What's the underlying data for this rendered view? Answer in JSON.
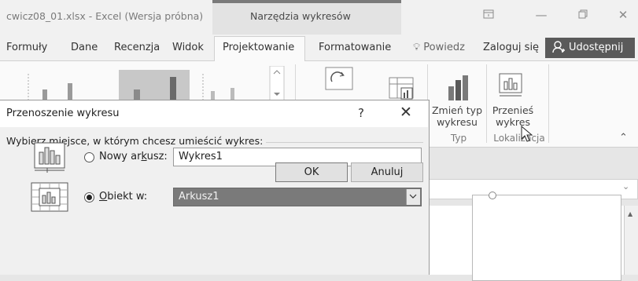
{
  "window": {
    "file_title": "cwicz08_01.xlsx - Excel (Wersja próbna)",
    "tools_label": "Narzędzia wykresów"
  },
  "tabs": [
    "Formuły",
    "Dane",
    "Recenzja",
    "Widok",
    "Projektowanie",
    "Formatowanie"
  ],
  "active_tab": "Projektowanie",
  "tellme": "Powiedz",
  "signin": "Zaloguj się",
  "share": "Udostępnij",
  "ribbon": {
    "change_type": [
      "Zmień typ",
      "wykresu"
    ],
    "change_type_group": "Typ",
    "move_chart": [
      "Przenieś",
      "wykres"
    ],
    "move_group": "Lokalizacja"
  },
  "dialog": {
    "title": "Przenoszenie wykresu",
    "help": "?",
    "close": "✕",
    "instruction": "Wybierz miejsce, w którym chcesz umieścić wykres:",
    "option_new_sheet": {
      "label_pre": "Nowy ar",
      "label_u": "k",
      "label_post": "usz:",
      "value": "Wykres1",
      "selected": false
    },
    "option_object": {
      "label_u": "O",
      "label_post": "biekt w:",
      "value": "Arkusz1",
      "selected": true
    },
    "ok": "OK",
    "cancel": "Anuluj"
  },
  "colors": {
    "share_bg": "#5a5a5a",
    "combo_bg": "#7a7a7a",
    "dialog_bg": "#f0f0f0"
  }
}
